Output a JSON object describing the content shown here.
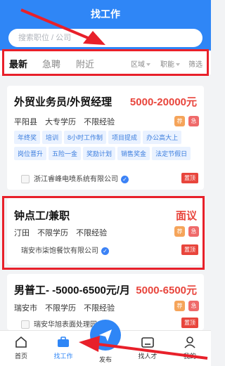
{
  "header": {
    "title": "找工作"
  },
  "search": {
    "placeholder": "搜索职位 / 公司"
  },
  "filter": {
    "tabs": [
      {
        "label": "最新",
        "active": true
      },
      {
        "label": "急聘",
        "active": false
      },
      {
        "label": "附近",
        "active": false
      }
    ],
    "dropdowns": [
      {
        "label": "区域"
      },
      {
        "label": "职能"
      },
      {
        "label": "筛选"
      }
    ]
  },
  "jobs": [
    {
      "title": "外贸业务员/外贸经理",
      "salary": "5000-20000元",
      "location": "平阳县",
      "education": "大专学历",
      "experience": "不限经验",
      "badges": [
        "荐",
        "急"
      ],
      "tags": [
        "年终奖",
        "培训",
        "8小时工作制",
        "项目提成",
        "办公高大上",
        "岗位晋升",
        "五险一金",
        "奖励计划",
        "销售奖金",
        "法定节假日"
      ],
      "company": "浙江睿峰电喷系统有限公司",
      "verified": "✓",
      "pin_label": "置顶"
    },
    {
      "title": "钟点工/兼职",
      "salary": "面议",
      "location": "汀田",
      "education": "不限学历",
      "experience": "不限经验",
      "badges": [
        "荐",
        "急"
      ],
      "company": "瑞安市柒饱餐饮有限公司",
      "verified": "✓",
      "pin_label": "置顶"
    },
    {
      "title": "男普工- -5000-6500元/月",
      "salary": "5000-6500元",
      "location": "瑞安市",
      "education": "不限学历",
      "experience": "不限经验",
      "badges": [
        "荐",
        "急"
      ],
      "company": "瑞安华旭表面处理园",
      "pin_label": "置顶"
    }
  ],
  "bottom_nav": [
    {
      "label": "首页",
      "icon": "home-icon"
    },
    {
      "label": "找工作",
      "icon": "briefcase-icon",
      "active": true
    },
    {
      "label": "发布",
      "icon": "paper-plane-icon"
    },
    {
      "label": "找人才",
      "icon": "id-card-icon"
    },
    {
      "label": "我的",
      "icon": "person-icon"
    }
  ],
  "colors": {
    "primary": "#2f86f6",
    "salary": "#e8453c",
    "annotation": "#e8202a"
  }
}
